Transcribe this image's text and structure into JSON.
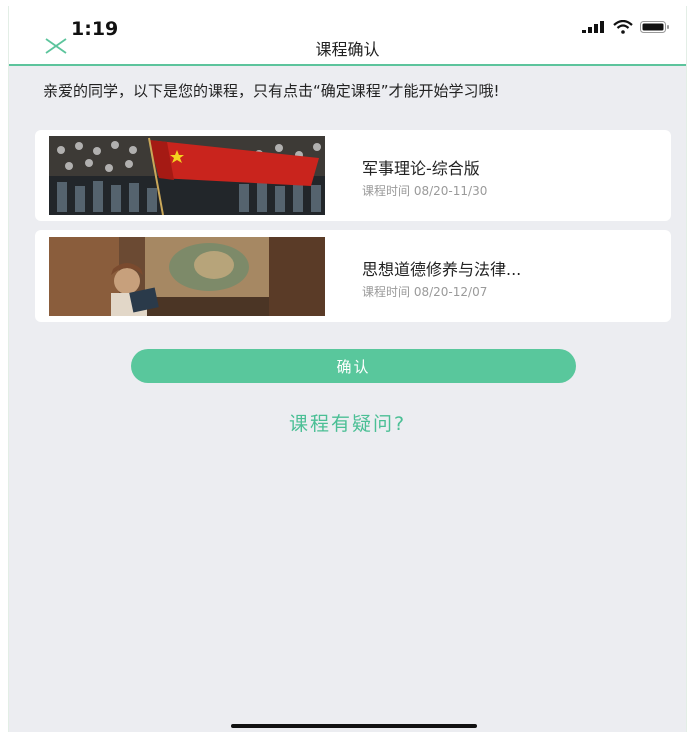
{
  "status_bar": {
    "time": "1:19"
  },
  "header": {
    "title": "课程确认"
  },
  "intro_text": "亲爱的同学，以下是您的课程，只有点击“确定课程”才能开始学习哦!",
  "courses": [
    {
      "title": "军事理论-综合版",
      "date_label": "课程时间",
      "date_range": "08/20-11/30"
    },
    {
      "title": "思想道德修养与法律...",
      "date_label": "课程时间",
      "date_range": "08/20-12/07"
    }
  ],
  "confirm_button": "确认",
  "question_link": "课程有疑问?",
  "colors": {
    "accent": "#59c79c",
    "link": "#4bbf95",
    "background": "#ecedf1"
  }
}
